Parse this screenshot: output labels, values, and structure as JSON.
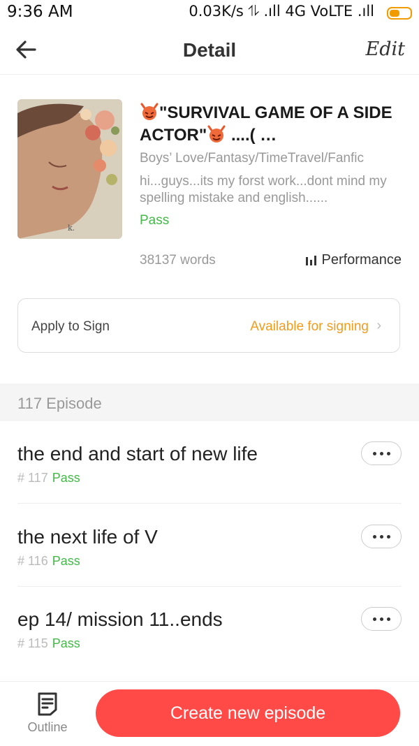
{
  "status_bar": {
    "time": "9:36 AM",
    "network": "0.03K/s ⥮ .ıll 4G VoLTE .ıll"
  },
  "header": {
    "title": "Detail",
    "edit_label": "Edit"
  },
  "book": {
    "title_text": "\"SURVIVAL GAME OF A SIDE ACTOR\"",
    "title_suffix": " ....( …",
    "genre": "Boys’ Love/Fantasy/TimeTravel/Fanfic",
    "description": "hi...guys...its my forst work...dont mind my spelling mistake and english......",
    "status": "Pass",
    "words": "38137 words",
    "performance_label": "Performance",
    "cover_signature": "k."
  },
  "sign": {
    "label": "Apply to Sign",
    "status": "Available for signing"
  },
  "episodes": {
    "count_label": "117 Episode",
    "items": [
      {
        "title": "the end and start of new life",
        "number": "# 117",
        "status": "Pass"
      },
      {
        "title": "the next life of V",
        "number": "# 116",
        "status": "Pass"
      },
      {
        "title": "ep 14/ mission 11..ends",
        "number": "# 115",
        "status": "Pass"
      }
    ]
  },
  "bottom": {
    "outline_label": "Outline",
    "create_label": "Create new episode"
  },
  "colors": {
    "accent": "#ff4a48",
    "pass": "#44b949",
    "sign_status": "#f39b1a",
    "battery": "#f29b00"
  }
}
